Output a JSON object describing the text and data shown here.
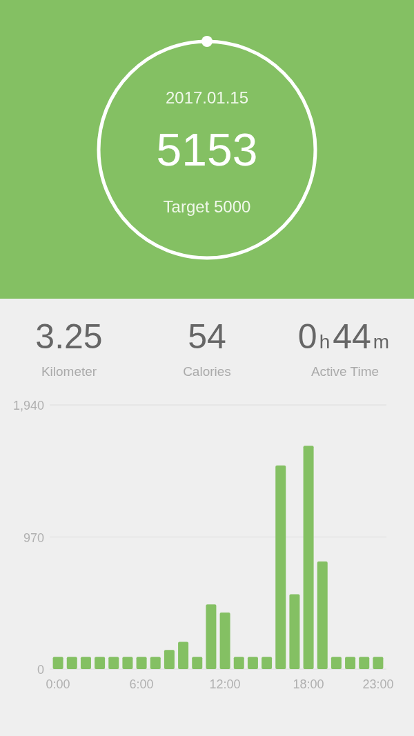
{
  "summary": {
    "date": "2017.01.15",
    "steps": "5153",
    "target": "Target 5000",
    "level": 1
  },
  "stats": [
    {
      "parts": [
        {
          "kind": "number",
          "text": "3.25"
        }
      ],
      "label": "Kilometer"
    },
    {
      "parts": [
        {
          "kind": "number",
          "text": "54"
        }
      ],
      "label": "Calories"
    },
    {
      "parts": [
        {
          "kind": "number",
          "text": "0"
        },
        {
          "kind": "unit",
          "text": "h"
        },
        {
          "kind": "number",
          "text": "44"
        },
        {
          "kind": "unit",
          "text": "m"
        }
      ],
      "label": "Active Time"
    }
  ],
  "hourly": {
    "chart_data": {
      "type": "bar",
      "x": [
        0,
        1,
        2,
        3,
        4,
        5,
        6,
        7,
        8,
        9,
        10,
        11,
        12,
        13,
        14,
        15,
        16,
        17,
        18,
        19,
        20,
        21,
        22,
        23
      ],
      "xlim": [
        -0.6,
        23.6
      ],
      "series": [
        {
          "color": "#84c063",
          "values": [
            90,
            90,
            90,
            90,
            90,
            90,
            90,
            90,
            140,
            200,
            90,
            475,
            415,
            90,
            90,
            90,
            1495,
            550,
            1640,
            790,
            90,
            90,
            90,
            90
          ]
        }
      ],
      "ylim": [
        0,
        1940
      ],
      "yticks": [
        {
          "value": 0,
          "label": "0"
        },
        {
          "value": 970,
          "label": "970"
        },
        {
          "value": 1940,
          "label": "1,940"
        }
      ],
      "xticks": [
        {
          "value": 0,
          "label": "0:00"
        },
        {
          "value": 6,
          "label": "6:00"
        },
        {
          "value": 12,
          "label": "12:00"
        },
        {
          "value": 18,
          "label": "18:00"
        },
        {
          "value": 23,
          "label": "23:00"
        }
      ]
    }
  }
}
